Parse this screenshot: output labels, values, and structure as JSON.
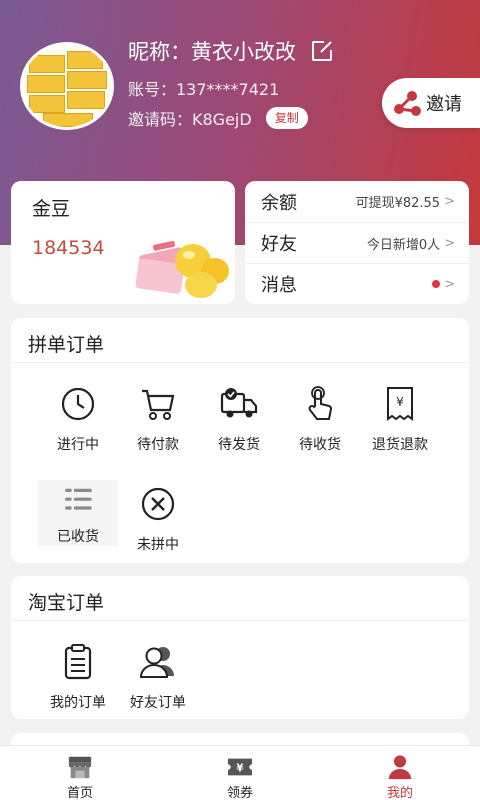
{
  "profile": {
    "nickname": "昵称：黄衣小改改",
    "account": "账号：137****7421",
    "invite_code": "邀请码：K8GejD",
    "copy_label": "复制",
    "invite_label": "邀请"
  },
  "gold": {
    "title": "金豆",
    "value": "184534"
  },
  "side": {
    "balance_label": "余额",
    "balance_value": "可提现¥82.55",
    "friends_label": "好友",
    "friends_value": "今日新增0人",
    "messages_label": "消息"
  },
  "group_orders": {
    "title": "拼单订单",
    "items": [
      {
        "label": "进行中",
        "icon": "clock-icon"
      },
      {
        "label": "待付款",
        "icon": "cart-icon"
      },
      {
        "label": "待发货",
        "icon": "truck-icon"
      },
      {
        "label": "待收货",
        "icon": "tap-hand-icon"
      },
      {
        "label": "退货退款",
        "icon": "refund-receipt-icon"
      },
      {
        "label": "已收货",
        "icon": "list-icon"
      },
      {
        "label": "未拼中",
        "icon": "x-circle-icon"
      }
    ]
  },
  "taobao_orders": {
    "title": "淘宝订单",
    "items": [
      {
        "label": "我的订单",
        "icon": "clipboard-icon"
      },
      {
        "label": "好友订单",
        "icon": "friends-icon"
      }
    ]
  },
  "tabbar": {
    "items": [
      {
        "label": "首页",
        "icon": "shop-icon"
      },
      {
        "label": "领券",
        "icon": "coupon-icon"
      },
      {
        "label": "我的",
        "icon": "person-icon"
      }
    ],
    "active": "我的",
    "active_color": "#c4393d"
  },
  "colors": {
    "header_start": "#7a5a93",
    "header_end": "#c4393d",
    "accent": "#c4393d"
  }
}
